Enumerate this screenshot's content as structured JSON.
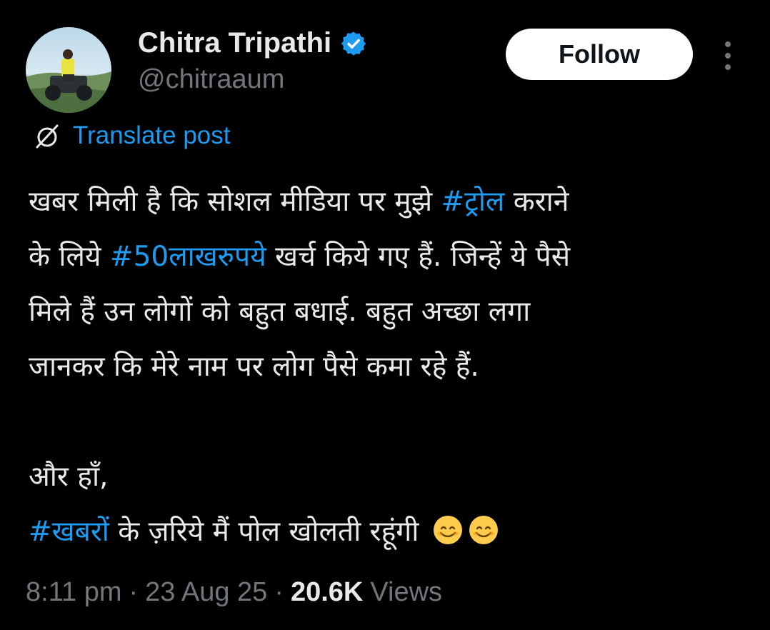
{
  "author": {
    "name": "Chitra Tripathi",
    "handle": "@chitraaum",
    "verified": true,
    "avatar_icon": "profile-photo-atv",
    "verified_color": "#1d9bf0"
  },
  "actions": {
    "follow_label": "Follow",
    "more_icon": "more-vertical-icon"
  },
  "translate": {
    "label": "Translate post",
    "icon": "translate-globe-icon"
  },
  "post": {
    "line1": {
      "text": "खबर मिली है कि सोशल मीडिया पर मुझे ",
      "tag": "#ट्रोल",
      "tail": " कराने"
    },
    "line2": {
      "text": "के लिये ",
      "tag": "#50लाखरुपये",
      "tail": " खर्च किये गए हैं.  जिन्हें ये पैसे"
    },
    "line3": "मिले हैं उन लोगों को बहुत बधाई. बहुत अच्छा लगा",
    "line4": "जानकर कि मेरे नाम पर लोग पैसे कमा रहे हैं.",
    "line5": "और हाँ,",
    "line6": {
      "tag": "#खबरों",
      "text": " के ज़रिये मैं पोल खोलती रहूंगी"
    },
    "emoji": "smiling-face-icon"
  },
  "meta": {
    "time": "8:11 pm",
    "separator": "·",
    "date": "23 Aug 25",
    "views_count": "20.6K",
    "views_label": "Views"
  },
  "colors": {
    "accent": "#1d9bf0",
    "background": "#000000",
    "text": "#e7e9ea",
    "muted": "#71767b"
  }
}
